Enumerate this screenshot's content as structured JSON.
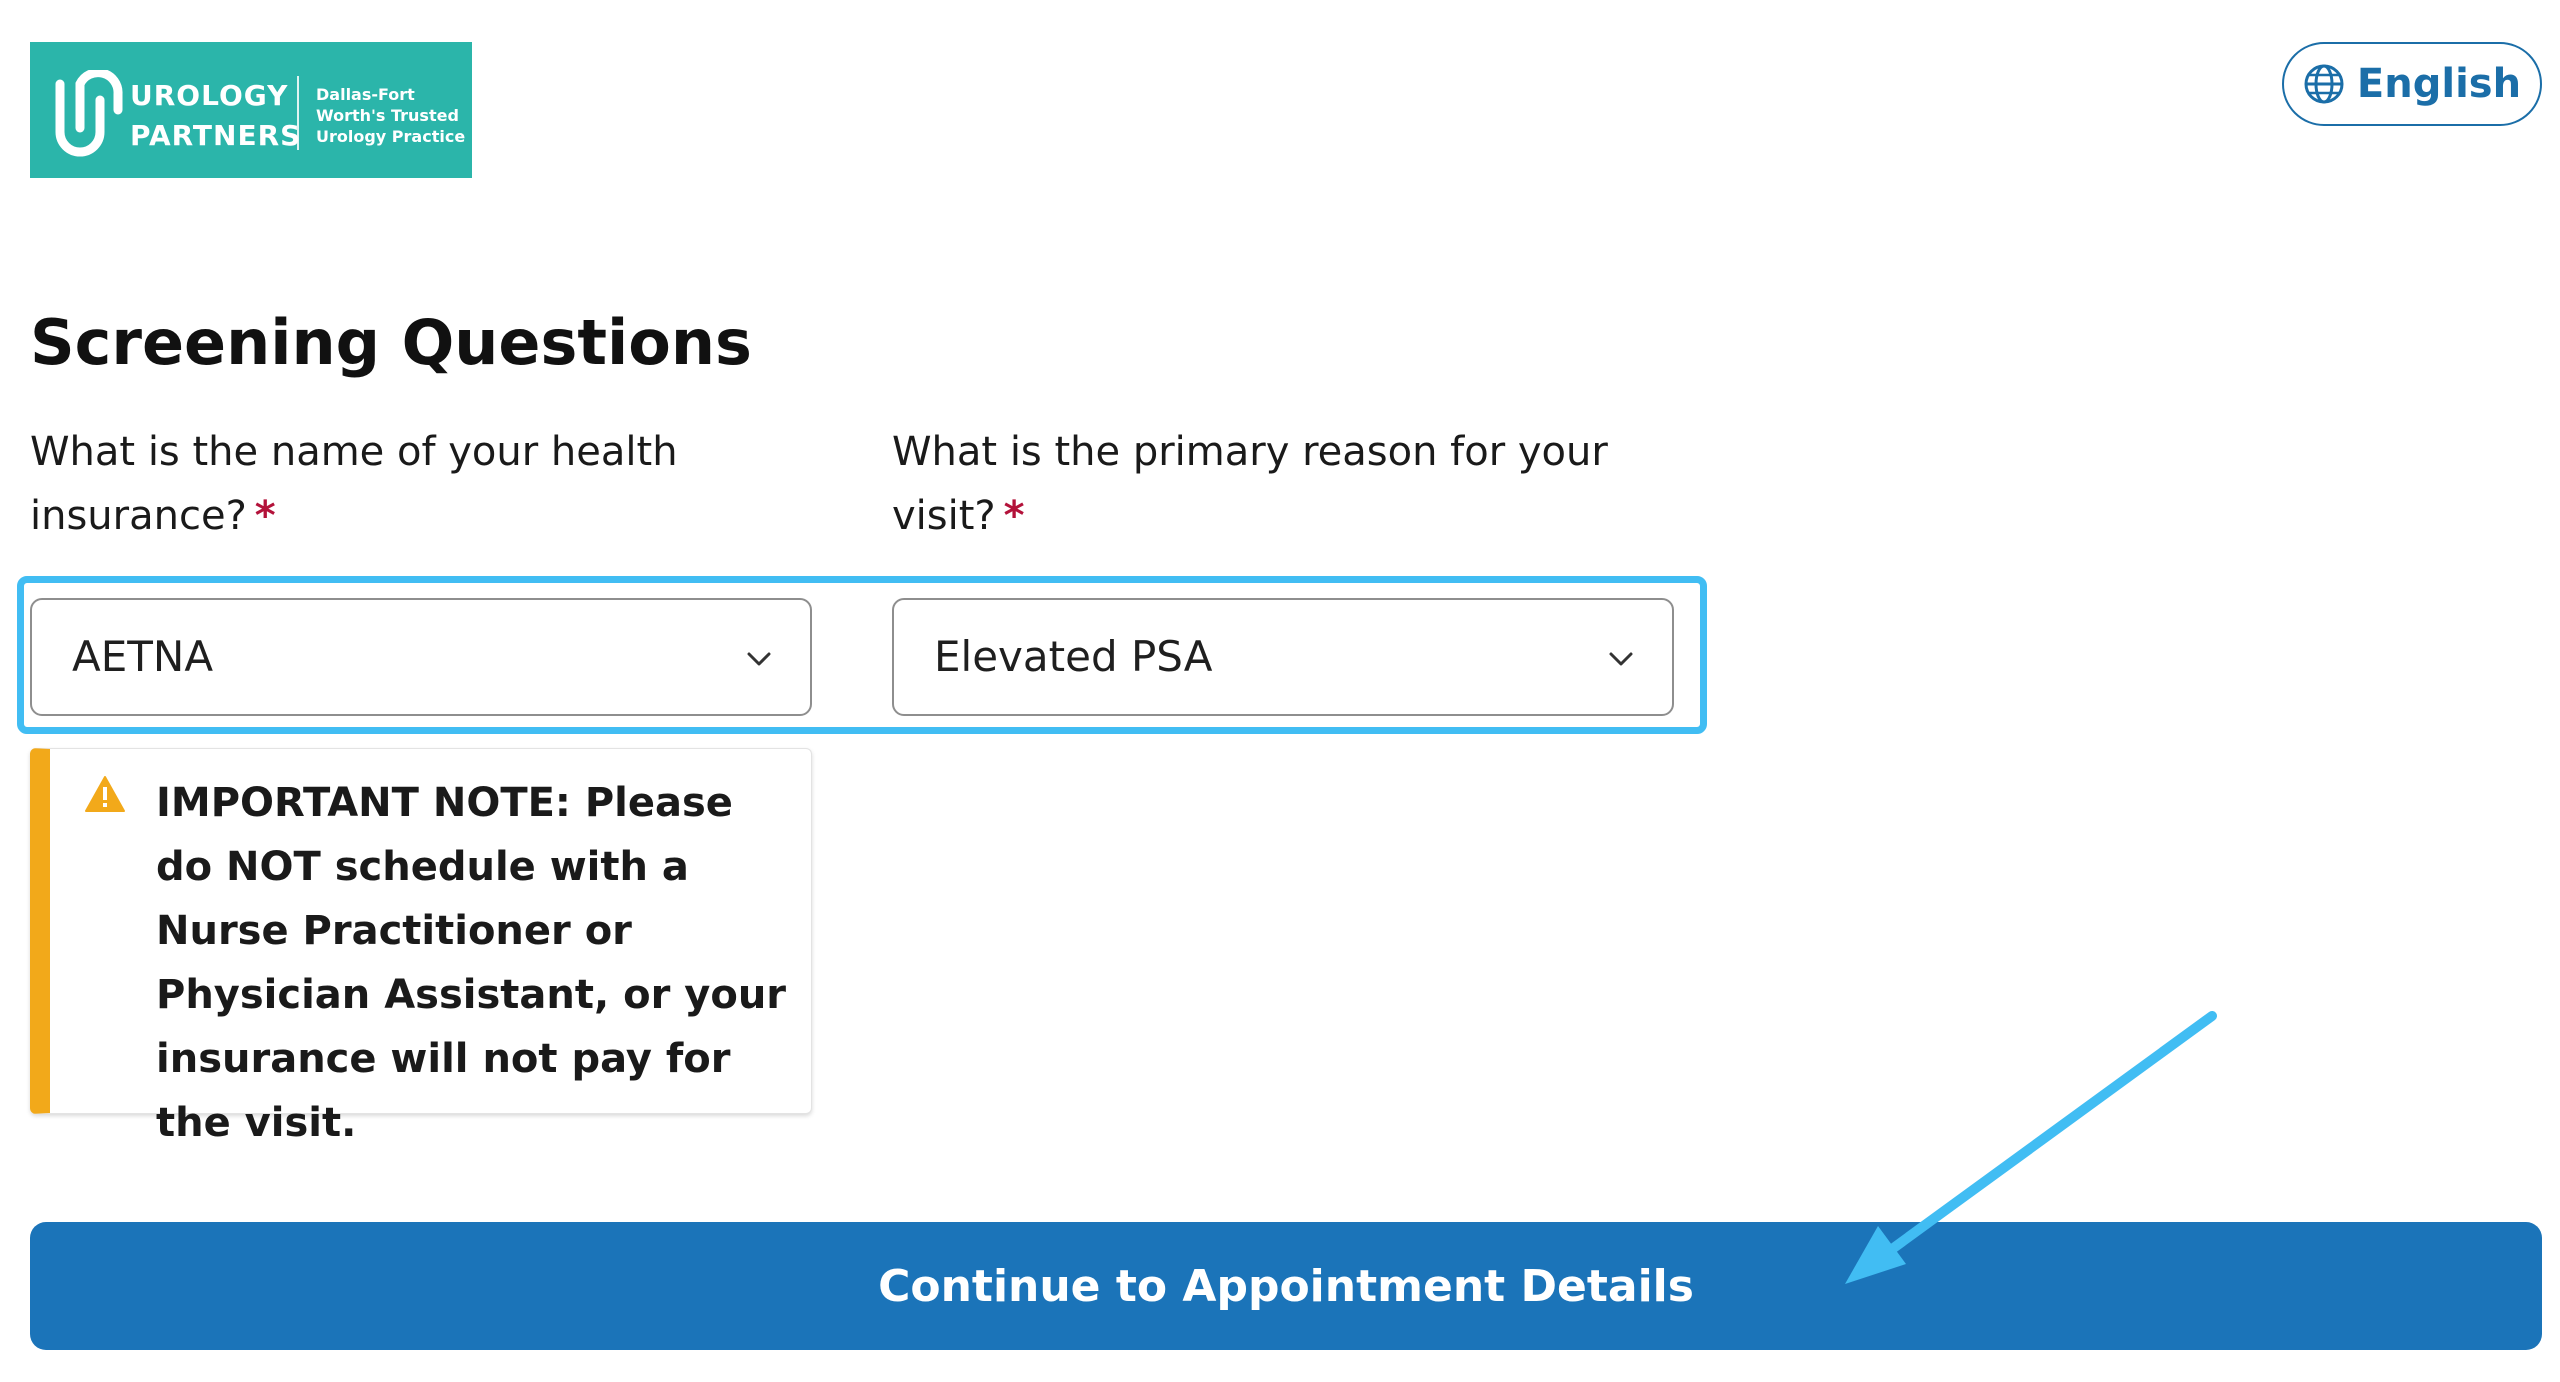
{
  "header": {
    "logo": {
      "name_line1": "UROLOGY",
      "name_line2": "PARTNERS",
      "tagline_line1": "Dallas-Fort",
      "tagline_line2": "Worth's Trusted",
      "tagline_line3": "Urology Practice",
      "brand_color": "#2bb5aa"
    },
    "language": {
      "label": "English",
      "icon": "globe-icon"
    }
  },
  "form": {
    "title": "Screening Questions",
    "questions": [
      {
        "label": "What is the name of your health insurance?",
        "required_marker": "*",
        "selected_value": "AETNA"
      },
      {
        "label": "What is the primary reason for your visit?",
        "required_marker": "*",
        "selected_value": "Elevated PSA"
      }
    ],
    "note": {
      "text": "IMPORTANT NOTE: Please do NOT schedule with a Nurse Practitioner or Physician Assistant, or your insurance will not pay for the visit.",
      "icon": "warning-icon",
      "accent_color": "#f2a91a"
    },
    "continue_button": {
      "label": "Continue to Appointment Details",
      "color": "#1b74b9"
    }
  },
  "annotations": {
    "highlight_color": "#41bdf3",
    "arrow_color": "#41bdf3"
  }
}
